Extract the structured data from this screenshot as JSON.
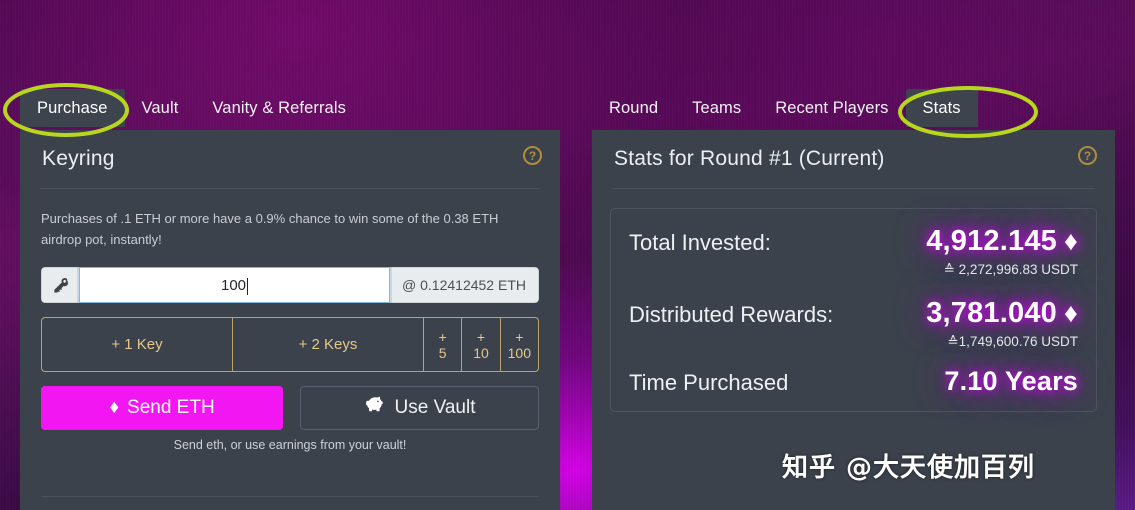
{
  "tabs_left": [
    {
      "label": "Purchase",
      "active": true
    },
    {
      "label": "Vault",
      "active": false
    },
    {
      "label": "Vanity & Referrals",
      "active": false
    }
  ],
  "tabs_right": [
    {
      "label": "Round",
      "active": false
    },
    {
      "label": "Teams",
      "active": false
    },
    {
      "label": "Recent Players",
      "active": false
    },
    {
      "label": "Stats",
      "active": true
    }
  ],
  "left_panel": {
    "title": "Keyring",
    "help_icon": "question-mark-icon",
    "help_glyph": "?",
    "blurb": "Purchases of .1 ETH or more have a 0.9% chance to win some of the 0.38 ETH airdrop pot, instantly!",
    "input": {
      "prefix_icon": "key-icon",
      "value": "100",
      "placeholder": "0",
      "suffix": "@ 0.12412452 ETH"
    },
    "key_buttons": [
      {
        "label": "+ 1 Key"
      },
      {
        "label": "+ 2 Keys"
      }
    ],
    "quick_add": [
      {
        "plus": "+",
        "num": "5"
      },
      {
        "plus": "+",
        "num": "10"
      },
      {
        "plus": "+",
        "num": "100"
      }
    ],
    "send_button": {
      "label": "Send ETH",
      "icon": "ethereum-icon",
      "glyph": "♦",
      "color": "#f217f2"
    },
    "vault_button": {
      "label": "Use Vault",
      "icon": "piggy-bank-icon",
      "glyph": "🐷"
    },
    "hint": "Send eth, or use earnings from your vault!"
  },
  "right_panel": {
    "title": "Stats for Round #1 (Current)",
    "help_icon": "question-mark-icon",
    "help_glyph": "?",
    "stats": [
      {
        "label": "Total Invested:",
        "value": "4,912.145",
        "unit_glyph": "♦",
        "sub": "≙ 2,272,996.83 USDT"
      },
      {
        "label": "Distributed Rewards:",
        "value": "3,781.040",
        "unit_glyph": "♦",
        "sub": "≙1,749,600.76 USDT"
      },
      {
        "label": "Time Purchased",
        "value": "7.10 Years",
        "unit_glyph": "",
        "sub": ""
      }
    ]
  },
  "annotations": {
    "color": "#b9d61f",
    "purchase_tab_circled": true,
    "stats_tab_circled": true
  },
  "watermark": "知乎 @大天使加百列"
}
